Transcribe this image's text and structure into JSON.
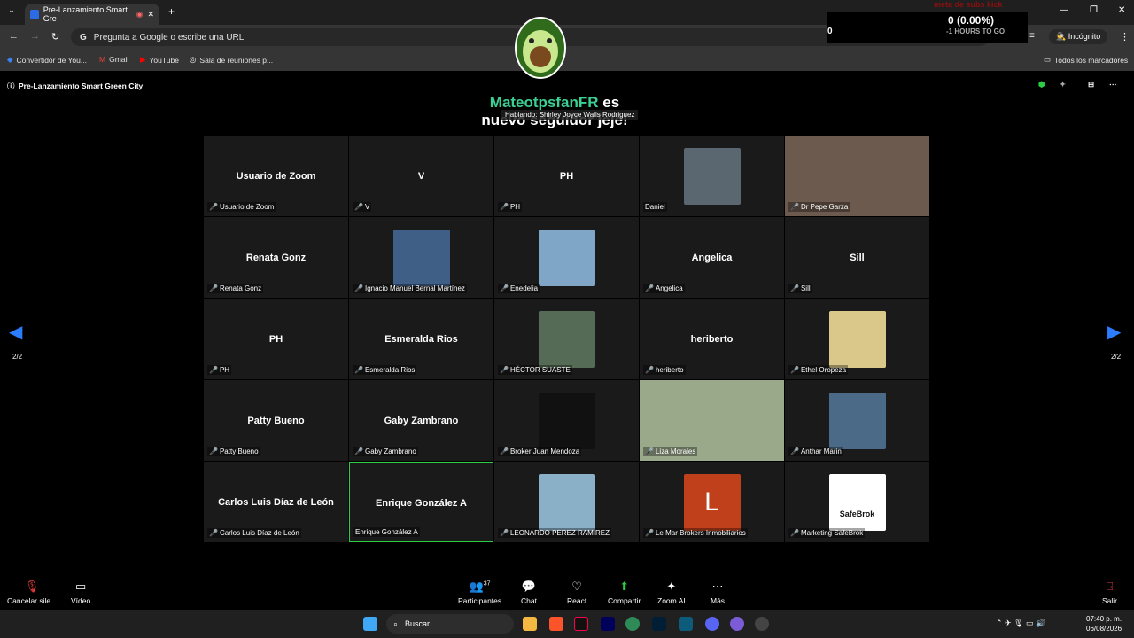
{
  "browser": {
    "tab_title": "Pre-Lanzamiento Smart Gre",
    "omnibox_placeholder": "Pregunta a Google o escribe una URL",
    "profile": "Incógnito",
    "bookmarks": [
      "Convertidor de You...",
      "Gmail",
      "YouTube",
      "Sala de reuniones p..."
    ],
    "all_bookmarks": "Todos los marcadores"
  },
  "stream": {
    "goal_title": "meta de subs kick",
    "percent": "0 (0.00%)",
    "count": "0",
    "remaining": "-1 HOURS TO GO",
    "alert_user": "MateotpsfanFR",
    "alert_text1": "es",
    "alert_text2": "nuevo seguidor jeje!"
  },
  "zoom": {
    "meeting_title": "Pre-Lanzamiento Smart Green City",
    "speaking": "Hablando: Shirley Joyce Walls Rodriguez",
    "page_left": "2/2",
    "page_right": "2/2"
  },
  "tiles": [
    {
      "name": "Usuario de Zoom",
      "label": "Usuario de Zoom",
      "kind": "name",
      "muted": true
    },
    {
      "name": "V",
      "label": "V",
      "kind": "name",
      "muted": true
    },
    {
      "name": "PH",
      "label": "PH",
      "kind": "name",
      "muted": true
    },
    {
      "name": "",
      "label": "Daniel",
      "kind": "photo",
      "muted": false,
      "color": "#5a6770"
    },
    {
      "name": "",
      "label": "Dr Pepe Garza",
      "kind": "video",
      "muted": true,
      "color": "#6d5a4e"
    },
    {
      "name": "Renata Gonz",
      "label": "Renata Gonz",
      "kind": "name",
      "muted": true
    },
    {
      "name": "",
      "label": "Ignacio Manuel Bernal Martínez",
      "kind": "photo",
      "muted": true,
      "color": "#3f5f87"
    },
    {
      "name": "",
      "label": "Enedelia",
      "kind": "photo",
      "muted": true,
      "color": "#7fa6c7"
    },
    {
      "name": "Angelica",
      "label": "Angelica",
      "kind": "name",
      "muted": true
    },
    {
      "name": "Sill",
      "label": "Sill",
      "kind": "name",
      "muted": true
    },
    {
      "name": "PH",
      "label": "PH",
      "kind": "name",
      "muted": true
    },
    {
      "name": "Esmeralda Rios",
      "label": "Esmeralda Rios",
      "kind": "name",
      "muted": true
    },
    {
      "name": "",
      "label": "HÉCTOR SUASTE",
      "kind": "photo",
      "muted": true,
      "color": "#556b55"
    },
    {
      "name": "heriberto",
      "label": "heriberto",
      "kind": "name",
      "muted": true
    },
    {
      "name": "",
      "label": "Ethel Oropeza",
      "kind": "photo",
      "muted": true,
      "color": "#d9c88a"
    },
    {
      "name": "Patty Bueno",
      "label": "Patty Bueno",
      "kind": "name",
      "muted": true
    },
    {
      "name": "Gaby Zambrano",
      "label": "Gaby Zambrano",
      "kind": "name",
      "muted": true
    },
    {
      "name": "",
      "label": "Broker Juan Mendoza",
      "kind": "photo",
      "muted": true,
      "color": "#111111"
    },
    {
      "name": "",
      "label": "Liza Morales",
      "kind": "video",
      "muted": true,
      "color": "#9aa98a"
    },
    {
      "name": "",
      "label": "Anthar Marin",
      "kind": "photo",
      "muted": true,
      "color": "#4a6a88"
    },
    {
      "name": "Carlos Luis Díaz de León",
      "label": "Carlos Luis Díaz de León",
      "kind": "name",
      "muted": true
    },
    {
      "name": "Enrique González A",
      "label": "Enrique González A",
      "kind": "name",
      "muted": false,
      "active": true
    },
    {
      "name": "",
      "label": "LEONARDO PEREZ RAMIREZ",
      "kind": "photo",
      "muted": true,
      "color": "#8ab0c8"
    },
    {
      "name": "L",
      "label": "Le Mar Brokers Inmobiliarios",
      "kind": "letter",
      "muted": true,
      "color": "#c0401c"
    },
    {
      "name": "SafeBrok",
      "label": "Marketing SafeBrok",
      "kind": "logo",
      "muted": true,
      "color": "#ffffff"
    }
  ],
  "controls": {
    "mute": "Cancelar sile...",
    "video": "Vídeo",
    "participants": "Participantes",
    "participants_count": "37",
    "chat": "Chat",
    "react": "React",
    "share": "Compartir",
    "ai": "Zoom AI",
    "more": "Más",
    "leave": "Salir"
  },
  "taskbar": {
    "search": "Buscar",
    "time": "07:40 p. m.",
    "date": "06/08/2026"
  }
}
